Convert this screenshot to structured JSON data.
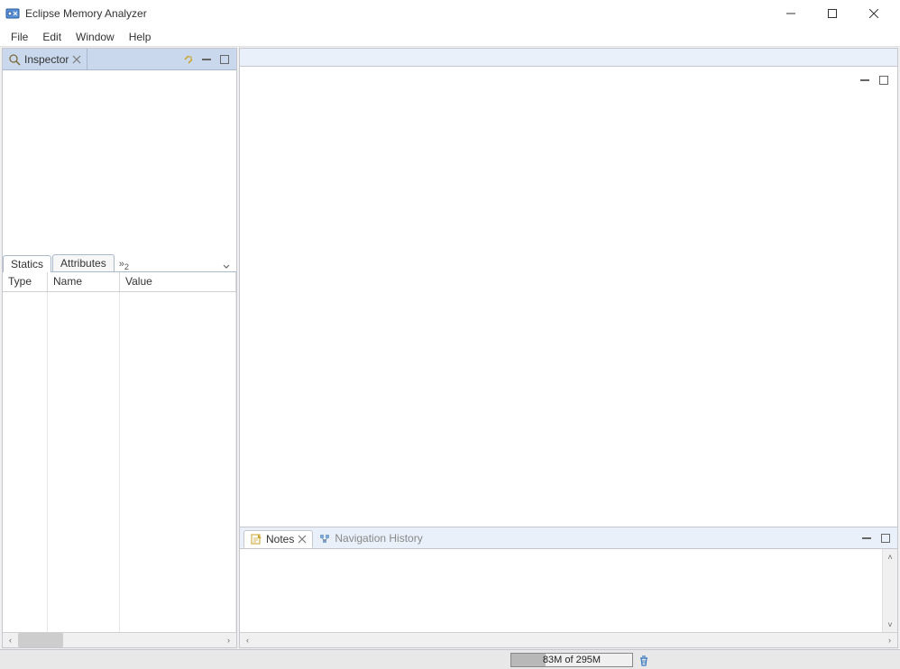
{
  "window": {
    "title": "Eclipse Memory Analyzer"
  },
  "menubar": {
    "items": [
      "File",
      "Edit",
      "Window",
      "Help"
    ]
  },
  "inspector": {
    "tab_label": "Inspector",
    "prop_tabs": {
      "statics": "Statics",
      "attributes": "Attributes",
      "more_count": "2"
    },
    "columns": {
      "type": "Type",
      "name": "Name",
      "value": "Value"
    }
  },
  "bottom_panel": {
    "notes": "Notes",
    "nav_history": "Navigation History"
  },
  "status": {
    "heap": "83M of 295M",
    "heap_pct": 28
  }
}
